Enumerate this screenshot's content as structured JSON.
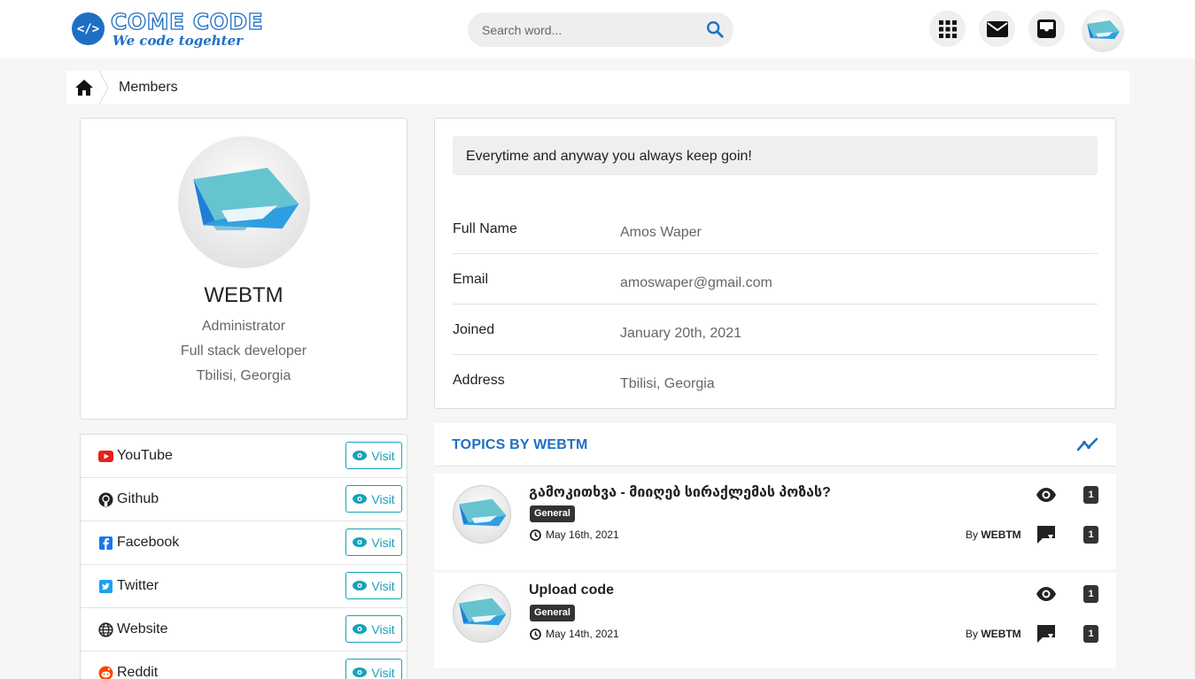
{
  "header": {
    "logo_title": "COME CODE",
    "logo_subtitle": "We code togehter",
    "logo_badge": "</>",
    "search_placeholder": "Search word..."
  },
  "breadcrumb": {
    "current": "Members"
  },
  "profile": {
    "name": "WEBTM",
    "role": "Administrator",
    "title": "Full stack developer",
    "location": "Tbilisi, Georgia"
  },
  "social": {
    "visit_label": "Visit",
    "items": [
      {
        "label": "YouTube",
        "icon": "youtube-icon",
        "color": "#e62117"
      },
      {
        "label": "Github",
        "icon": "github-icon",
        "color": "#222222"
      },
      {
        "label": "Facebook",
        "icon": "facebook-icon",
        "color": "#1877f2"
      },
      {
        "label": "Twitter",
        "icon": "twitter-icon",
        "color": "#1da1f2"
      },
      {
        "label": "Website",
        "icon": "globe-icon",
        "color": "#222222"
      },
      {
        "label": "Reddit",
        "icon": "reddit-icon",
        "color": "#ff4500"
      }
    ]
  },
  "info": {
    "quote": "Everytime and anyway you always keep goin!",
    "rows": [
      {
        "key": "Full Name",
        "value": "Amos Waper"
      },
      {
        "key": "Email",
        "value": "amoswaper@gmail.com"
      },
      {
        "key": "Joined",
        "value": "January 20th, 2021"
      },
      {
        "key": "Address",
        "value": "Tbilisi, Georgia"
      }
    ]
  },
  "topics": {
    "heading": "TOPICS BY WEBTM",
    "by_prefix": "By",
    "items": [
      {
        "title": "გამოკითხვა - მიიღებ სირაქლემას პოზას?",
        "category": "General",
        "date": "May 16th, 2021",
        "author": "WEBTM",
        "views": "1",
        "replies": "1"
      },
      {
        "title": "Upload code",
        "category": "General",
        "date": "May 14th, 2021",
        "author": "WEBTM",
        "views": "1",
        "replies": "1"
      }
    ]
  },
  "colors": {
    "brand": "#1e6fc4",
    "visit": "#17a2b8"
  }
}
